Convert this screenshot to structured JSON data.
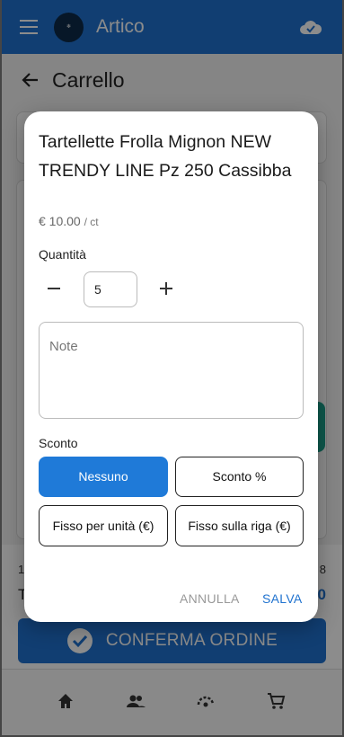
{
  "app": {
    "title": "Artico",
    "logo_text": "ARTICO"
  },
  "page": {
    "title": "Carrello"
  },
  "summary": {
    "left_text": "1",
    "right_text": "8",
    "total_label": "T",
    "total_value": "0"
  },
  "confirm_button": {
    "label": "CONFERMA ORDINE"
  },
  "bottom_nav": {
    "items": [
      "home-icon",
      "people-icon",
      "catalog-icon",
      "cart-icon"
    ]
  },
  "dialog": {
    "product_title": "Tartellette Frolla Mignon NEW TRENDY LINE Pz 250 Cassibba",
    "price": "€ 10.00",
    "price_unit": "/ ct",
    "quantity_label": "Quantità",
    "quantity_value": "5",
    "note_placeholder": "Note",
    "discount_label": "Sconto",
    "discount_options": [
      {
        "label": "Nessuno",
        "selected": true
      },
      {
        "label": "Sconto %",
        "selected": false
      },
      {
        "label": "Fisso per unità (€)",
        "selected": false
      },
      {
        "label": "Fisso sulla riga (€)",
        "selected": false
      }
    ],
    "cancel_label": "ANNULLA",
    "save_label": "SALVA"
  },
  "colors": {
    "primary": "#1f72cf",
    "selected_option": "#1f7ad8",
    "accent_teal": "#1aa08a"
  }
}
